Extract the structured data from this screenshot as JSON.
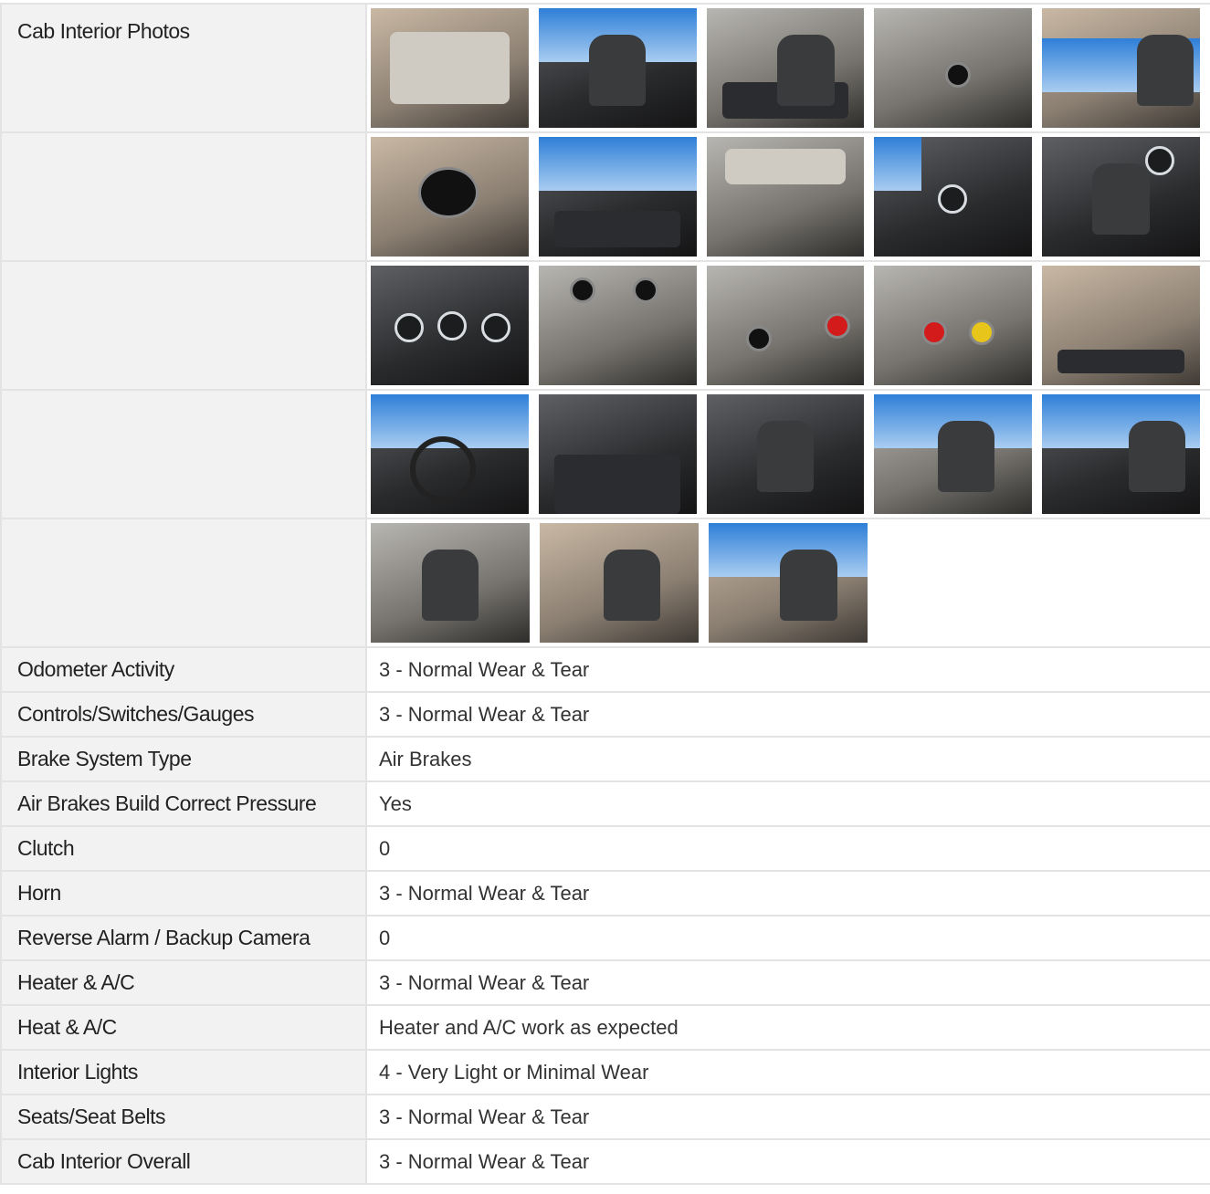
{
  "photo_section": {
    "label": "Cab Interior Photos",
    "rows": [
      [
        "speaker-overhead",
        "driver-seat-window",
        "dash-console",
        "switch-panel-cupholder",
        "headliner-window"
      ],
      [
        "rear-speaker-cover",
        "steering-wheel-dash",
        "dome-light",
        "shift-column",
        "seat-back-gauges"
      ],
      [
        "instrument-cluster",
        "switch-panel-cupholder-2",
        "hvac-controls",
        "brake-knobs",
        "switch-bank-radio"
      ],
      [
        "steering-wheel-wide",
        "floor-pedals",
        "passenger-seat",
        "driver-seat-side",
        "bench-seatbelt"
      ],
      [
        "seat-door-open",
        "cab-door-open",
        "door-exterior-open"
      ]
    ]
  },
  "rows": [
    {
      "label": "Odometer Activity",
      "value": "3 - Normal Wear & Tear"
    },
    {
      "label": "Controls/Switches/Gauges",
      "value": "3 - Normal Wear & Tear"
    },
    {
      "label": "Brake System Type",
      "value": "Air Brakes"
    },
    {
      "label": "Air Brakes Build Correct Pressure",
      "value": "Yes"
    },
    {
      "label": "Clutch",
      "value": "0"
    },
    {
      "label": "Horn",
      "value": "3 - Normal Wear & Tear"
    },
    {
      "label": "Reverse Alarm / Backup Camera",
      "value": "0"
    },
    {
      "label": "Heater & A/C",
      "value": "3 - Normal Wear & Tear"
    },
    {
      "label": "Heat & A/C",
      "value": "Heater and A/C work as expected"
    },
    {
      "label": "Interior Lights",
      "value": "4 - Very Light or Minimal Wear"
    },
    {
      "label": "Seats/Seat Belts",
      "value": "3 - Normal Wear & Tear"
    },
    {
      "label": "Cab Interior Overall",
      "value": "3 - Normal Wear & Tear"
    }
  ]
}
